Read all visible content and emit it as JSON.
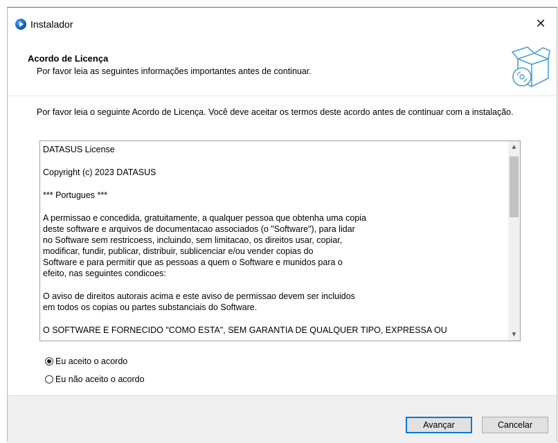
{
  "window": {
    "title": "Instalador",
    "close_label": "✕"
  },
  "header": {
    "title": "Acordo de Licença",
    "subtitle": "Por favor leia as seguintes informações importantes antes de continuar."
  },
  "intro": "Por favor leia o seguinte Acordo de Licença. Você deve aceitar os termos deste acordo antes de continuar com a instalação.",
  "license": {
    "paragraphs": [
      "DATASUS License",
      "Copyright (c) 2023 DATASUS",
      "*** Portugues ***",
      "A permissao e concedida, gratuitamente, a qualquer pessoa que obtenha uma copia\ndeste software e arquivos de documentacao associados (o \"Software\"), para lidar\nno Software sem restricoess, incluindo, sem limitacao, os direitos usar, copiar,\nmodificar, fundir, publicar, distribuir, sublicenciar e/ou vender copias do\nSoftware e para permitir que as pessoas a quem o Software e munidos para o\nefeito, nas seguintes condicoes:",
      "O aviso de direitos autorais acima e este aviso de permissao devem ser incluidos\nem todos os copias ou partes substanciais do Software.",
      "O SOFTWARE E FORNECIDO \"COMO ESTA\", SEM GARANTIA DE QUALQUER TIPO, EXPRESSA OU"
    ]
  },
  "options": {
    "accept": "Eu aceito o acordo",
    "decline": "Eu não aceito o acordo",
    "selected": "accept"
  },
  "buttons": {
    "next": "Avançar",
    "cancel": "Cancelar"
  },
  "icons": {
    "app": "installer-app-icon",
    "header": "software-box-cd-icon"
  }
}
